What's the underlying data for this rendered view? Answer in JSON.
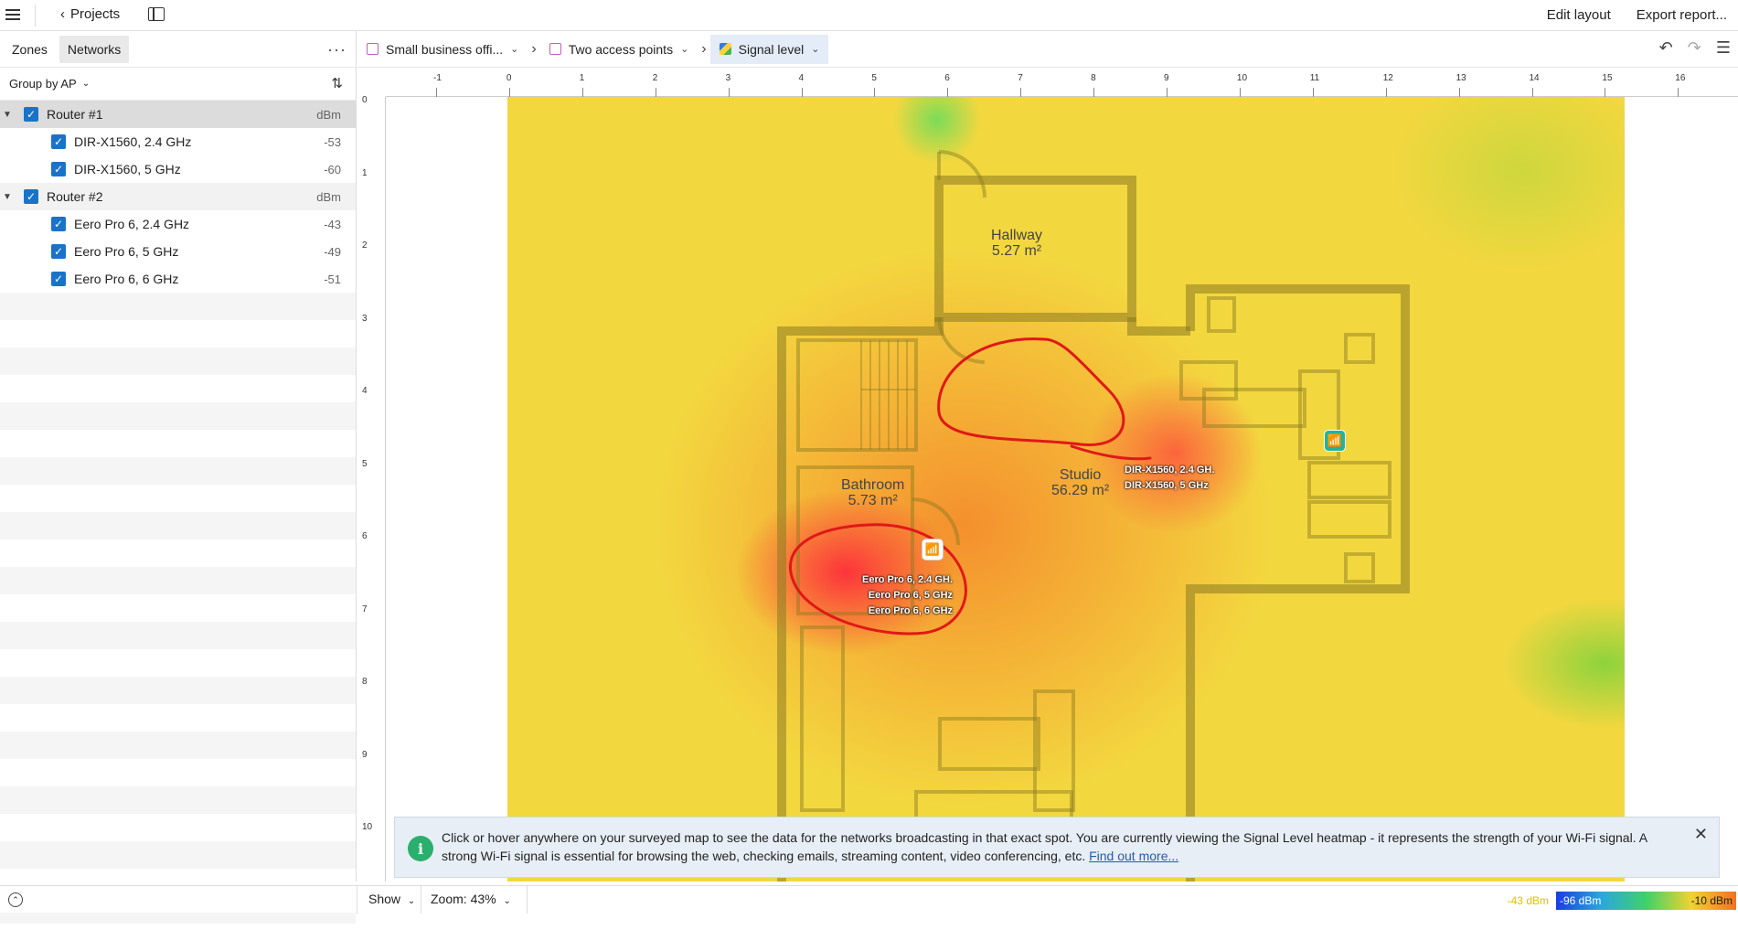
{
  "topbar": {
    "back_label": "Projects",
    "edit_layout": "Edit layout",
    "export_report": "Export report..."
  },
  "left": {
    "tabs": [
      "Zones",
      "Networks"
    ],
    "active_tab": "Networks",
    "group_by": "Group by AP",
    "groups": [
      {
        "name": "Router #1",
        "unit": "dBm",
        "children": [
          {
            "name": "DIR-X1560, 2.4 GHz",
            "value": "-53"
          },
          {
            "name": "DIR-X1560, 5 GHz",
            "value": "-60"
          }
        ]
      },
      {
        "name": "Router #2",
        "unit": "dBm",
        "children": [
          {
            "name": "Eero Pro 6, 2.4 GHz",
            "value": "-43"
          },
          {
            "name": "Eero Pro 6, 5 GHz",
            "value": "-49"
          },
          {
            "name": "Eero Pro 6, 6 GHz",
            "value": "-51"
          }
        ]
      }
    ]
  },
  "breadcrumb": {
    "project": "Small business offi...",
    "survey": "Two access points",
    "view": "Signal level"
  },
  "ruler": {
    "x_ticks": [
      "-1",
      "0",
      "1",
      "2",
      "3",
      "4",
      "5",
      "6",
      "7",
      "8",
      "9",
      "10",
      "11",
      "12",
      "13",
      "14",
      "15",
      "16"
    ],
    "y_ticks": [
      "0",
      "1",
      "2",
      "3",
      "4",
      "5",
      "6",
      "7",
      "8",
      "9",
      "10"
    ]
  },
  "map": {
    "rooms": [
      {
        "name": "Hallway",
        "area": "5.27 m²"
      },
      {
        "name": "Bathroom",
        "area": "5.73 m²"
      },
      {
        "name": "Studio",
        "area": "56.29 m²"
      }
    ],
    "ap1_labels": [
      "DIR-X1560, 2.4 GH.",
      "DIR-X1560, 5 GHz"
    ],
    "ap2_labels": [
      "Eero Pro 6, 2.4 GH.",
      "Eero Pro 6, 5 GHz",
      "Eero Pro 6, 6 GHz"
    ]
  },
  "info": {
    "text": "Click or hover anywhere on your surveyed map to see the data for the networks broadcasting in that exact spot. You are currently viewing the Signal Level heatmap - it represents the strength of your Wi-Fi signal. A strong Wi-Fi signal is essential for browsing the web, checking emails, streaming content, video conferencing, etc.",
    "link": "Find out more..."
  },
  "bottom": {
    "show": "Show",
    "zoom": "Zoom: 43%",
    "current_value": "-43 dBm",
    "legend_min": "-96 dBm",
    "legend_max": "-10 dBm"
  },
  "colors": {
    "accent": "#1a73c8",
    "ap_badge": "#1fb59a",
    "annotation": "#e01818"
  }
}
